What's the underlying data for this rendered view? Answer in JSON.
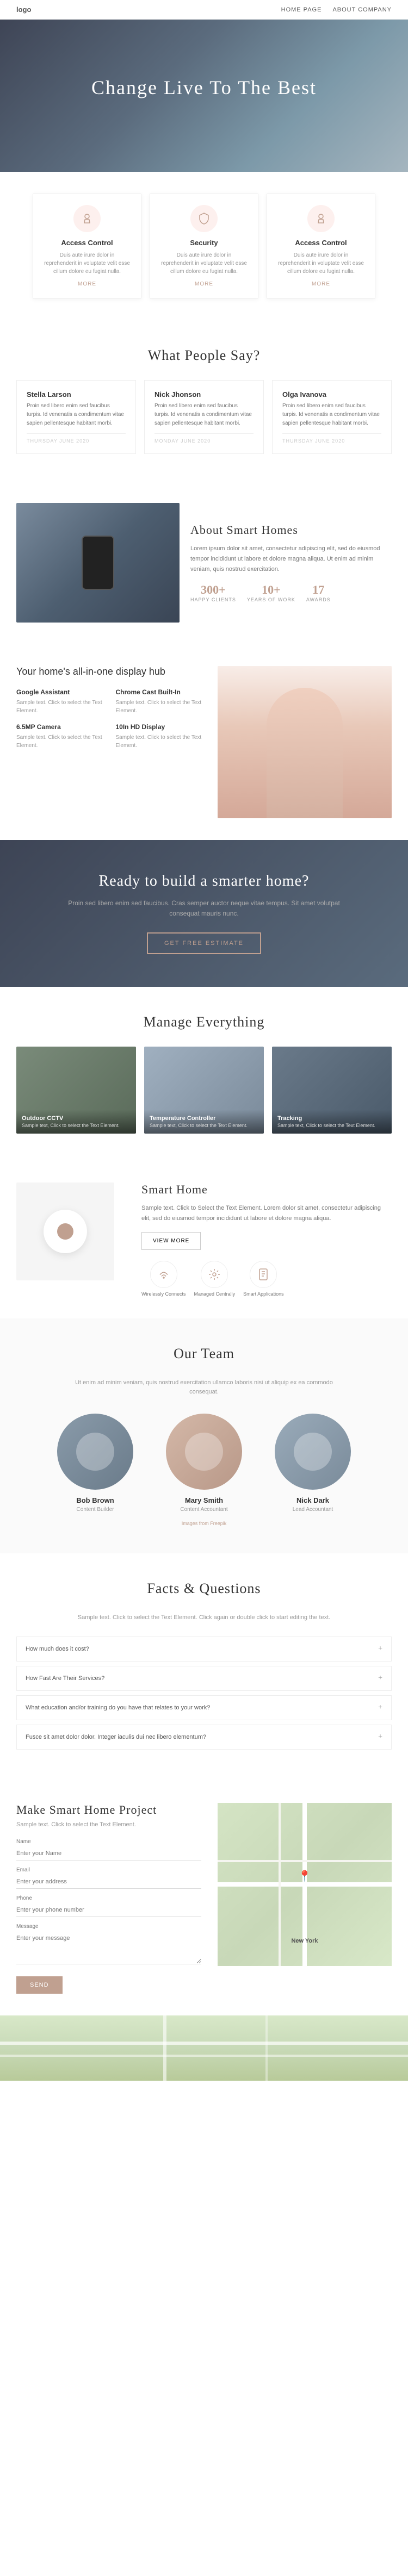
{
  "nav": {
    "logo": "logo",
    "links": [
      {
        "label": "HOME PAGE",
        "href": "#"
      },
      {
        "label": "ABOUT COMPANY",
        "href": "#"
      }
    ]
  },
  "hero": {
    "title": "Change Live To The Best"
  },
  "features": {
    "items": [
      {
        "title": "Access Control",
        "description": "Duis aute irure dolor in reprehenderit in voluptate velit esse cillum dolore eu fugiat nulla.",
        "more": "MORE"
      },
      {
        "title": "Security",
        "description": "Duis aute irure dolor in reprehenderit in voluptate velit esse cillum dolore eu fugiat nulla.",
        "more": "MORE"
      },
      {
        "title": "Access Control",
        "description": "Duis aute irure dolor in reprehenderit in voluptate velit esse cillum dolore eu fugiat nulla.",
        "more": "MORE"
      }
    ]
  },
  "testimonials": {
    "title": "What People Say?",
    "items": [
      {
        "name": "Stella Larson",
        "text": "Proin sed libero enim sed faucibus turpis. Id venenatis a condimentum vitae sapien pellentesque habitant morbi.",
        "date": "THURSDAY JUNE 2020"
      },
      {
        "name": "Nick Jhonson",
        "text": "Proin sed libero enim sed faucibus turpis. Id venenatis a condimentum vitae sapien pellentesque habitant morbi.",
        "date": "MONDAY JUNE 2020"
      },
      {
        "name": "Olga Ivanova",
        "text": "Proin sed libero enim sed faucibus turpis. Id venenatis a condimentum vitae sapien pellentesque habitant morbi.",
        "date": "THURSDAY JUNE 2020"
      }
    ]
  },
  "about": {
    "title": "About Smart Homes",
    "description": "Lorem ipsum dolor sit amet, consectetur adipiscing elit, sed do eiusmod tempor incididunt ut labore et dolore magna aliqua. Ut enim ad minim veniam, quis nostrud exercitation.",
    "stats": [
      {
        "number": "300+",
        "label": "HAPPY CLIENTS"
      },
      {
        "number": "10+",
        "label": "YEARS OF WORK"
      },
      {
        "number": "17",
        "label": "AWARDS"
      }
    ]
  },
  "hub": {
    "title": "Your home's all-in-one display hub",
    "features": [
      {
        "title": "Google Assistant",
        "description": "Sample text. Click to select the Text Element."
      },
      {
        "title": "Chrome Cast Built-In",
        "description": "Sample text. Click to select the Text Element."
      },
      {
        "title": "6.5MP Camera",
        "description": "Sample text. Click to select the Text Element."
      },
      {
        "title": "10In HD Display",
        "description": "Sample text. Click to select the Text Element."
      }
    ]
  },
  "cta": {
    "title": "Ready to build a smarter home?",
    "description": "Proin sed libero enim sed faucibus. Cras semper auctor neque vitae tempus. Sit amet volutpat consequat mauris nunc.",
    "button": "GET FREE ESTIMATE"
  },
  "manage": {
    "title": "Manage Everything",
    "items": [
      {
        "label": "Outdoor CCTV",
        "sublabel": "Sample text, Click to select the Text Element.",
        "type": "outdoor"
      },
      {
        "label": "Temperature Controller",
        "sublabel": "Sample text, Click to select the Text Element.",
        "type": "temp"
      },
      {
        "label": "Tracking",
        "sublabel": "Sample text, Click to select the Text Element.",
        "type": "tracking"
      }
    ]
  },
  "smarthome": {
    "title": "Smart Home",
    "description": "Sample text. Click to Select the Text Element. Lorem dolor sit amet, consectetur adipiscing elit, sed do eiusmod tempor incididunt ut labore et dolore magna aliqua.",
    "button": "VIEW MORE",
    "icons": [
      {
        "label": "Wirelessly Connects"
      },
      {
        "label": "Managed Centrally"
      },
      {
        "label": "Smart Applications"
      }
    ]
  },
  "team": {
    "title": "Our Team",
    "subtitle": "Ut enim ad minim veniam, quis nostrud exercitation ullamco laboris nisi ut aliquip ex ea commodo consequat.",
    "members": [
      {
        "name": "Bob Brown",
        "role": "Content Builder",
        "photo": "bob"
      },
      {
        "name": "Mary Smith",
        "role": "Content Accountant",
        "photo": "mary"
      },
      {
        "name": "Nick Dark",
        "role": "Lead Accountant",
        "photo": "nick"
      }
    ],
    "credit": "Images from Freepik"
  },
  "faq": {
    "title": "Facts & Questions",
    "subtitle": "Sample text. Click to select the Text Element. Click again or double click to start editing the text.",
    "items": [
      {
        "question": "How much does it cost?"
      },
      {
        "question": "How Fast Are Their Services?"
      },
      {
        "question": "What education and/or training do you have that relates to your work?"
      },
      {
        "question": "Fusce sit amet dolor dolor. Integer iaculis dui nec libero elementum?"
      }
    ]
  },
  "contact": {
    "title": "Make Smart Home Project",
    "subtitle": "Sample text. Click to select the Text Element.",
    "fields": {
      "name_label": "Name",
      "name_placeholder": "Enter your Name",
      "email_label": "Email",
      "email_placeholder": "Enter your address",
      "phone_label": "Phone",
      "phone_placeholder": "Enter your phone number",
      "message_label": "Message",
      "message_placeholder": "Enter your message"
    },
    "submit": "SEND",
    "map_label": "New York"
  },
  "icons": {
    "lock": "🔒",
    "shield": "🛡",
    "key": "🔑",
    "wifi": "📶",
    "control": "🎛",
    "app": "📱",
    "chevron": "+"
  }
}
